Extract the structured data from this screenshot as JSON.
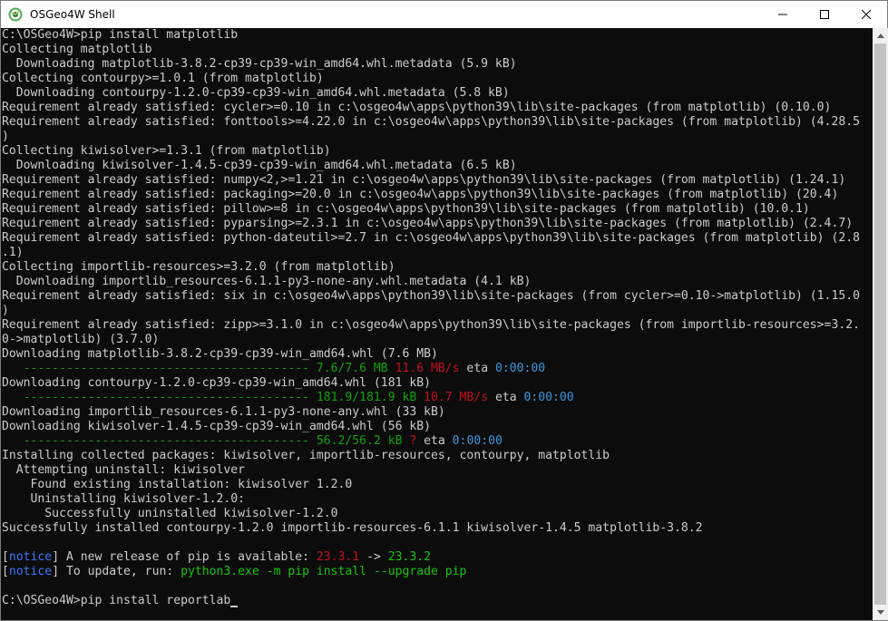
{
  "window": {
    "title": "OSGeo4W Shell",
    "icon": "osgeo4w-icon"
  },
  "controls": {
    "minimize_icon": "minimize-icon",
    "maximize_icon": "maximize-icon",
    "close_icon": "close-icon"
  },
  "colors": {
    "background": "#0c0c0c",
    "text": "#cccccc",
    "progress": "#13a10e",
    "rate": "#c50f1f",
    "eta": "#3a96dd",
    "notice": "#3b78ff",
    "command": "#16c60c"
  },
  "console": {
    "lines": [
      [
        {
          "t": "C:\\OSGeo4W>pip install matplotlib",
          "c": "default"
        }
      ],
      [
        {
          "t": "Collecting matplotlib",
          "c": "default"
        }
      ],
      [
        {
          "t": "  Downloading matplotlib-3.8.2-cp39-cp39-win_amd64.whl.metadata (5.9 kB)",
          "c": "default"
        }
      ],
      [
        {
          "t": "Collecting contourpy>=1.0.1 (from matplotlib)",
          "c": "default"
        }
      ],
      [
        {
          "t": "  Downloading contourpy-1.2.0-cp39-cp39-win_amd64.whl.metadata (5.8 kB)",
          "c": "default"
        }
      ],
      [
        {
          "t": "Requirement already satisfied: cycler>=0.10 in c:\\osgeo4w\\apps\\python39\\lib\\site-packages (from matplotlib) (0.10.0)",
          "c": "default"
        }
      ],
      [
        {
          "t": "Requirement already satisfied: fonttools>=4.22.0 in c:\\osgeo4w\\apps\\python39\\lib\\site-packages (from matplotlib) (4.28.5",
          "c": "default"
        }
      ],
      [
        {
          "t": ")",
          "c": "default"
        }
      ],
      [
        {
          "t": "Collecting kiwisolver>=1.3.1 (from matplotlib)",
          "c": "default"
        }
      ],
      [
        {
          "t": "  Downloading kiwisolver-1.4.5-cp39-cp39-win_amd64.whl.metadata (6.5 kB)",
          "c": "default"
        }
      ],
      [
        {
          "t": "Requirement already satisfied: numpy<2,>=1.21 in c:\\osgeo4w\\apps\\python39\\lib\\site-packages (from matplotlib) (1.24.1)",
          "c": "default"
        }
      ],
      [
        {
          "t": "Requirement already satisfied: packaging>=20.0 in c:\\osgeo4w\\apps\\python39\\lib\\site-packages (from matplotlib) (20.4)",
          "c": "default"
        }
      ],
      [
        {
          "t": "Requirement already satisfied: pillow>=8 in c:\\osgeo4w\\apps\\python39\\lib\\site-packages (from matplotlib) (10.0.1)",
          "c": "default"
        }
      ],
      [
        {
          "t": "Requirement already satisfied: pyparsing>=2.3.1 in c:\\osgeo4w\\apps\\python39\\lib\\site-packages (from matplotlib) (2.4.7)",
          "c": "default"
        }
      ],
      [
        {
          "t": "Requirement already satisfied: python-dateutil>=2.7 in c:\\osgeo4w\\apps\\python39\\lib\\site-packages (from matplotlib) (2.8",
          "c": "default"
        }
      ],
      [
        {
          "t": ".1)",
          "c": "default"
        }
      ],
      [
        {
          "t": "Collecting importlib-resources>=3.2.0 (from matplotlib)",
          "c": "default"
        }
      ],
      [
        {
          "t": "  Downloading importlib_resources-6.1.1-py3-none-any.whl.metadata (4.1 kB)",
          "c": "default"
        }
      ],
      [
        {
          "t": "Requirement already satisfied: six in c:\\osgeo4w\\apps\\python39\\lib\\site-packages (from cycler>=0.10->matplotlib) (1.15.0",
          "c": "default"
        }
      ],
      [
        {
          "t": ")",
          "c": "default"
        }
      ],
      [
        {
          "t": "Requirement already satisfied: zipp>=3.1.0 in c:\\osgeo4w\\apps\\python39\\lib\\site-packages (from importlib-resources>=3.2.",
          "c": "default"
        }
      ],
      [
        {
          "t": "0->matplotlib) (3.7.0)",
          "c": "default"
        }
      ],
      [
        {
          "t": "Downloading matplotlib-3.8.2-cp39-cp39-win_amd64.whl (7.6 MB)",
          "c": "default"
        }
      ],
      [
        {
          "t": "   ---------------------------------------- ",
          "c": "green"
        },
        {
          "t": "7.6/7.6 MB",
          "c": "green"
        },
        {
          "t": " ",
          "c": "default"
        },
        {
          "t": "11.6 MB/s",
          "c": "red"
        },
        {
          "t": " eta ",
          "c": "default"
        },
        {
          "t": "0:00:00",
          "c": "cyan"
        }
      ],
      [
        {
          "t": "Downloading contourpy-1.2.0-cp39-cp39-win_amd64.whl (181 kB)",
          "c": "default"
        }
      ],
      [
        {
          "t": "   ---------------------------------------- ",
          "c": "green"
        },
        {
          "t": "181.9/181.9 kB",
          "c": "green"
        },
        {
          "t": " ",
          "c": "default"
        },
        {
          "t": "10.7 MB/s",
          "c": "red"
        },
        {
          "t": " eta ",
          "c": "default"
        },
        {
          "t": "0:00:00",
          "c": "cyan"
        }
      ],
      [
        {
          "t": "Downloading importlib_resources-6.1.1-py3-none-any.whl (33 kB)",
          "c": "default"
        }
      ],
      [
        {
          "t": "Downloading kiwisolver-1.4.5-cp39-cp39-win_amd64.whl (56 kB)",
          "c": "default"
        }
      ],
      [
        {
          "t": "   ---------------------------------------- ",
          "c": "green"
        },
        {
          "t": "56.2/56.2 kB",
          "c": "green"
        },
        {
          "t": " ",
          "c": "default"
        },
        {
          "t": "?",
          "c": "red"
        },
        {
          "t": " eta ",
          "c": "default"
        },
        {
          "t": "0:00:00",
          "c": "cyan"
        }
      ],
      [
        {
          "t": "Installing collected packages: kiwisolver, importlib-resources, contourpy, matplotlib",
          "c": "default"
        }
      ],
      [
        {
          "t": "  Attempting uninstall: kiwisolver",
          "c": "default"
        }
      ],
      [
        {
          "t": "    Found existing installation: kiwisolver 1.2.0",
          "c": "default"
        }
      ],
      [
        {
          "t": "    Uninstalling kiwisolver-1.2.0:",
          "c": "default"
        }
      ],
      [
        {
          "t": "      Successfully uninstalled kiwisolver-1.2.0",
          "c": "default"
        }
      ],
      [
        {
          "t": "Successfully installed contourpy-1.2.0 importlib-resources-6.1.1 kiwisolver-1.4.5 matplotlib-3.8.2",
          "c": "default"
        }
      ],
      [
        {
          "t": "",
          "c": "default"
        }
      ],
      [
        {
          "t": "[",
          "c": "default"
        },
        {
          "t": "notice",
          "c": "notice"
        },
        {
          "t": "] A new release of pip is available: ",
          "c": "default"
        },
        {
          "t": "23.3.1",
          "c": "red"
        },
        {
          "t": " -> ",
          "c": "default"
        },
        {
          "t": "23.3.2",
          "c": "command"
        }
      ],
      [
        {
          "t": "[",
          "c": "default"
        },
        {
          "t": "notice",
          "c": "notice"
        },
        {
          "t": "] To update, run: ",
          "c": "default"
        },
        {
          "t": "python3.exe -m pip install --upgrade pip",
          "c": "command"
        }
      ],
      [
        {
          "t": "",
          "c": "default"
        }
      ],
      [
        {
          "t": "C:\\OSGeo4W>pip install reportlab",
          "c": "default"
        }
      ]
    ]
  }
}
